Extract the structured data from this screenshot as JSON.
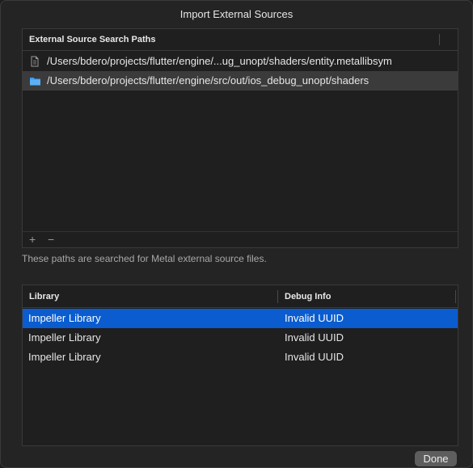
{
  "window": {
    "title": "Import External Sources"
  },
  "search_paths": {
    "header": "External Source Search Paths",
    "items": [
      {
        "icon": "file-icon",
        "path": "/Users/bdero/projects/flutter/engine/...ug_unopt/shaders/entity.metallibsym",
        "selected": false
      },
      {
        "icon": "folder-icon",
        "path": "/Users/bdero/projects/flutter/engine/src/out/ios_debug_unopt/shaders",
        "selected": true
      }
    ],
    "add_label": "+",
    "remove_label": "−"
  },
  "help_text": "These paths are searched for Metal external source files.",
  "libraries": {
    "columns": [
      "Library",
      "Debug Info"
    ],
    "rows": [
      {
        "library": "Impeller Library",
        "debug_info": "Invalid UUID",
        "selected": true
      },
      {
        "library": "Impeller Library",
        "debug_info": "Invalid UUID",
        "selected": false
      },
      {
        "library": "Impeller Library",
        "debug_info": "Invalid UUID",
        "selected": false
      }
    ]
  },
  "done_label": "Done",
  "colors": {
    "selection_blue": "#0a5ccf",
    "folder_blue": "#3a9ef5",
    "window_bg": "#242424"
  }
}
